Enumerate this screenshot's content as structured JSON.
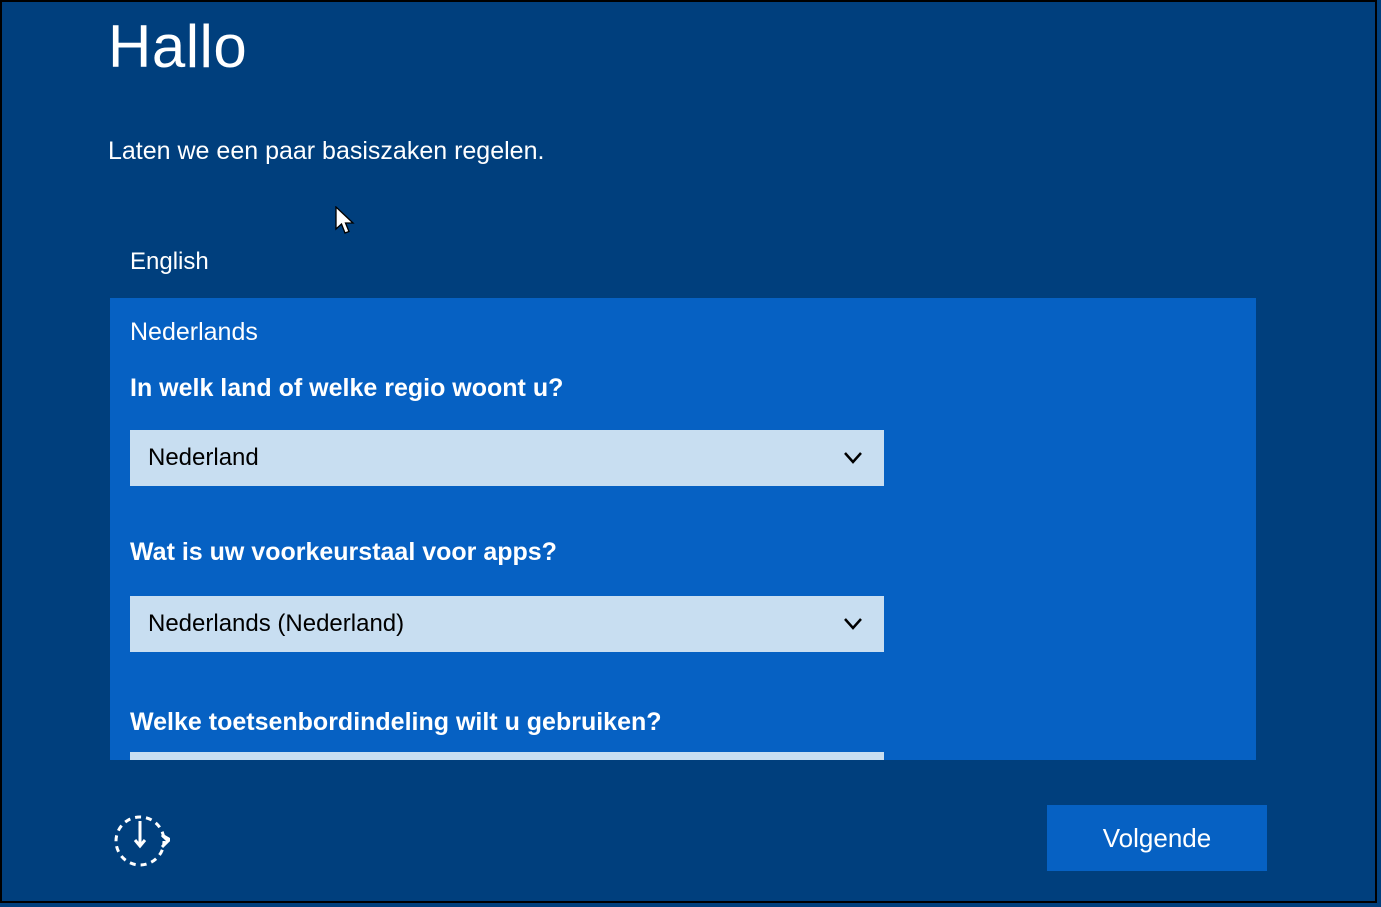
{
  "header": {
    "title": "Hallo",
    "subtitle": "Laten we een paar basiszaken regelen."
  },
  "languages": {
    "unselected": "English",
    "selected": "Nederlands"
  },
  "questions": {
    "country_label": "In welk land of welke regio woont u?",
    "country_value": "Nederland",
    "applang_label": "Wat is uw voorkeurstaal voor apps?",
    "applang_value": "Nederlands (Nederland)",
    "keyboard_label": "Welke toetsenbordindeling wilt u gebruiken?"
  },
  "footer": {
    "next_label": "Volgende"
  }
}
